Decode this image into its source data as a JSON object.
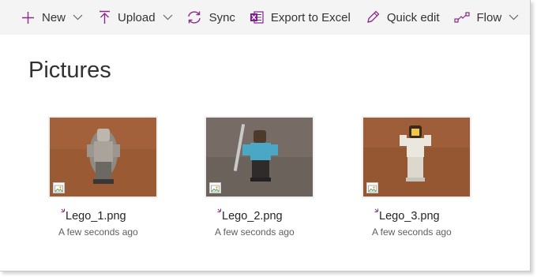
{
  "commandbar": {
    "new_label": "New",
    "upload_label": "Upload",
    "sync_label": "Sync",
    "export_label": "Export to Excel",
    "quickedit_label": "Quick edit",
    "flow_label": "Flow"
  },
  "page": {
    "title": "Pictures"
  },
  "files": [
    {
      "name": "Lego_1.png",
      "modified": "A few seconds ago"
    },
    {
      "name": "Lego_2.png",
      "modified": "A few seconds ago"
    },
    {
      "name": "Lego_3.png",
      "modified": "A few seconds ago"
    }
  ],
  "colors": {
    "accent": "#8a2a8a",
    "excel": "#7e1f8e",
    "text": "#333333",
    "commandbar_bg": "#f4f4f4"
  },
  "icons": [
    "plus-icon",
    "chevron-down-icon",
    "upload-arrow-icon",
    "sync-icon",
    "excel-icon",
    "pencil-icon",
    "flow-icon",
    "image-file-icon",
    "new-item-icon"
  ]
}
